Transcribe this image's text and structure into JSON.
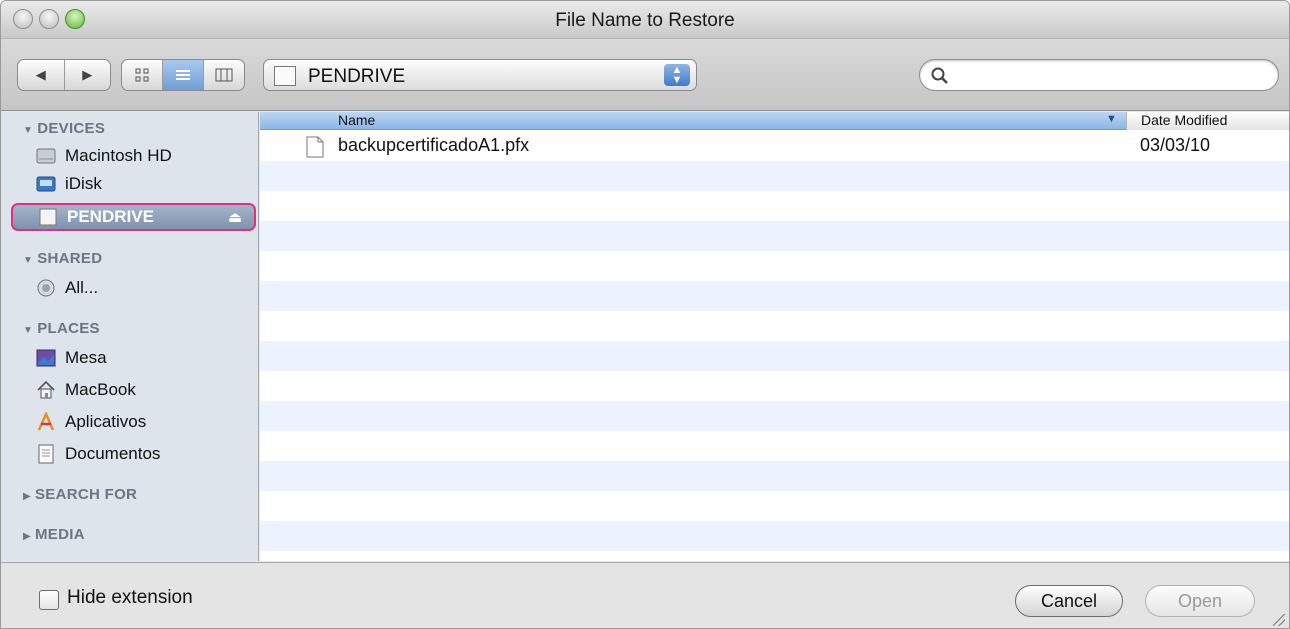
{
  "window": {
    "title": "File Name to Restore"
  },
  "toolbar": {
    "location": "PENDRIVE",
    "search": {
      "value": "",
      "placeholder": ""
    }
  },
  "sidebar": {
    "groups": [
      {
        "label": "DEVICES",
        "items": [
          {
            "label": "Macintosh HD",
            "icon": "hard-drive-icon"
          },
          {
            "label": "iDisk",
            "icon": "idisk-icon"
          },
          {
            "label": "PENDRIVE",
            "icon": "usb-drive-icon",
            "selected": true
          }
        ]
      },
      {
        "label": "SHARED",
        "items": [
          {
            "label": "All...",
            "icon": "network-icon"
          }
        ]
      },
      {
        "label": "PLACES",
        "items": [
          {
            "label": "Mesa",
            "icon": "desktop-icon"
          },
          {
            "label": "MacBook",
            "icon": "home-icon"
          },
          {
            "label": "Aplicativos",
            "icon": "applications-icon"
          },
          {
            "label": "Documentos",
            "icon": "documents-icon"
          }
        ]
      },
      {
        "label": "SEARCH FOR",
        "items": []
      },
      {
        "label": "MEDIA",
        "items": []
      }
    ]
  },
  "filelist": {
    "columns": {
      "name": "Name",
      "date": "Date Modified"
    },
    "rows": [
      {
        "name": "backupcertificadoA1.pfx",
        "date": "03/03/10"
      }
    ]
  },
  "bottom": {
    "hide_extension_label": "Hide extension",
    "cancel_label": "Cancel",
    "open_label": "Open"
  }
}
